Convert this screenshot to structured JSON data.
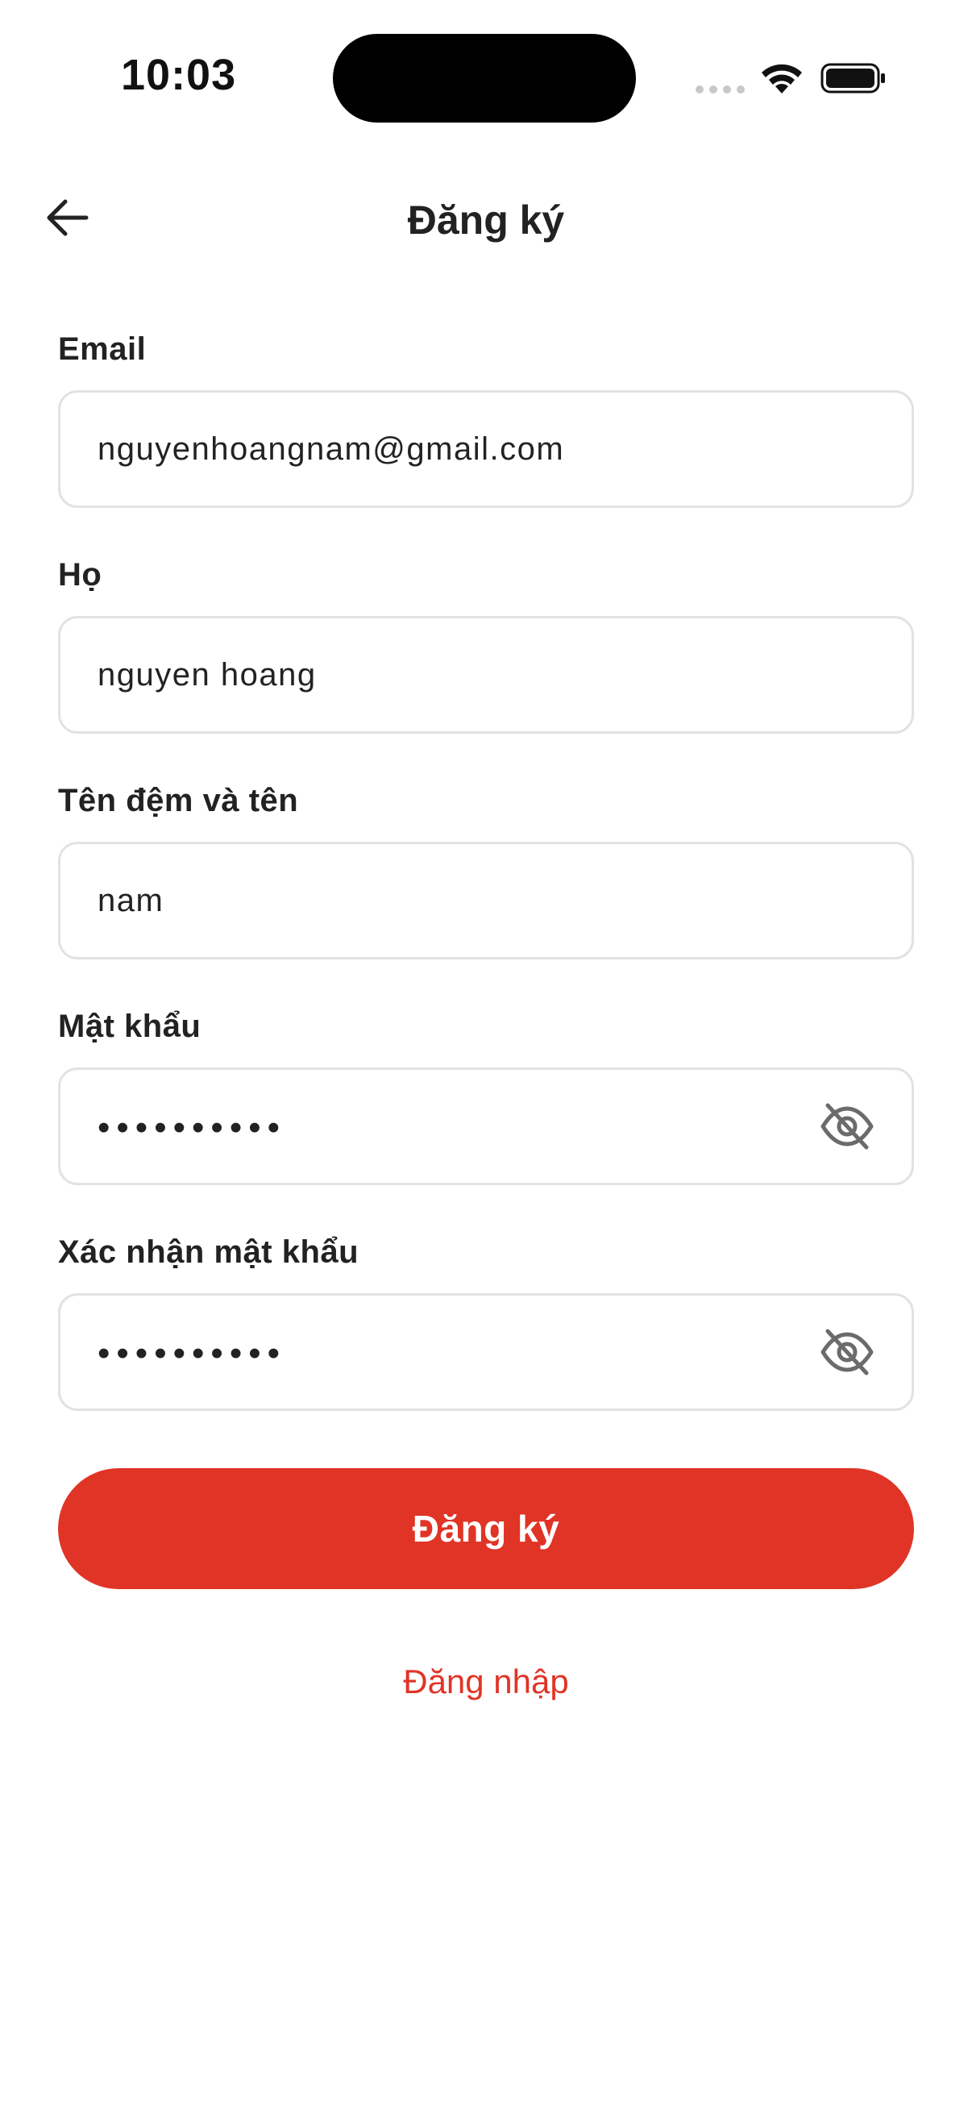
{
  "status_bar": {
    "time": "10:03",
    "icons": [
      "signal-dots-icon",
      "wifi-icon",
      "battery-icon"
    ]
  },
  "header": {
    "back_icon": "arrow-left-icon",
    "title": "Đăng ký"
  },
  "form": {
    "email": {
      "label": "Email",
      "value": "nguyenhoangnam@gmail.com"
    },
    "last_name": {
      "label": "Họ",
      "value": "nguyen hoang"
    },
    "first_name": {
      "label": "Tên đệm và tên",
      "value": "nam"
    },
    "password": {
      "label": "Mật khẩu",
      "value": "••••••••••",
      "toggle_icon": "eye-off-icon"
    },
    "confirm_password": {
      "label": "Xác nhận mật khẩu",
      "value": "••••••••••",
      "toggle_icon": "eye-off-icon"
    }
  },
  "actions": {
    "register_label": "Đăng ký",
    "login_label": "Đăng nhập"
  },
  "colors": {
    "accent": "#e03427",
    "border": "#e2e2e2",
    "text": "#222222"
  }
}
